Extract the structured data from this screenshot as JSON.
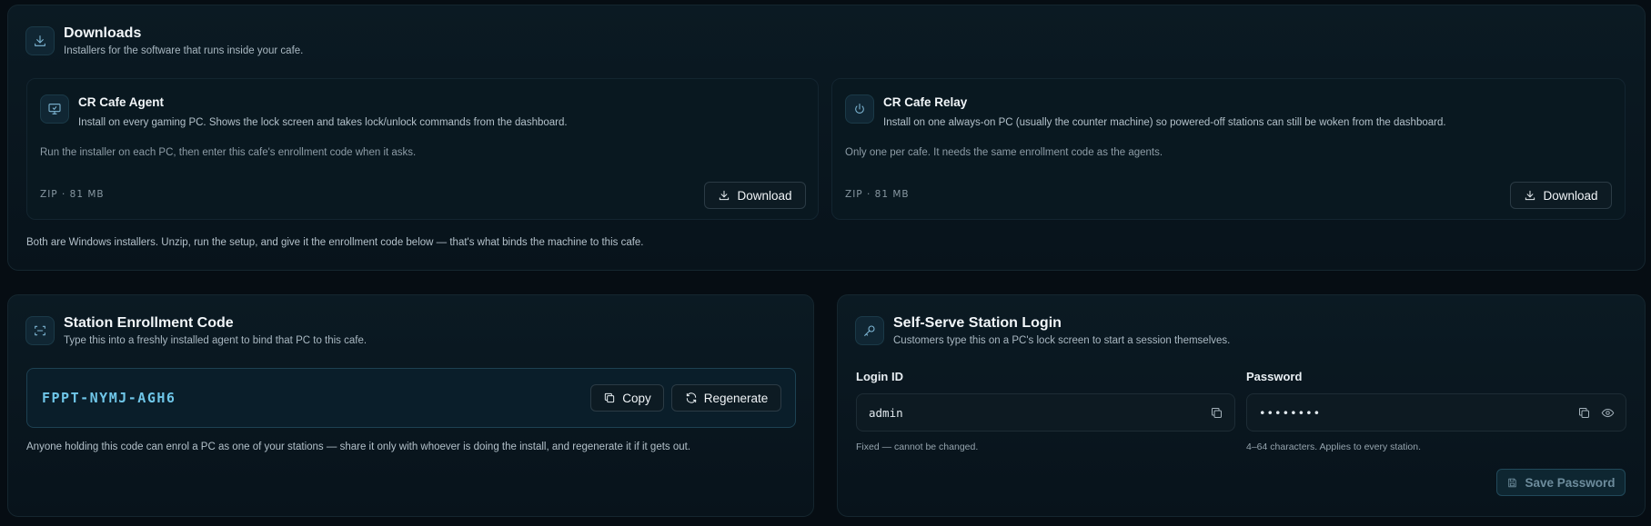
{
  "downloads": {
    "title": "Downloads",
    "subtitle": "Installers for the software that runs inside your cafe.",
    "icon": "download-icon",
    "agent": {
      "title": "CR Cafe Agent",
      "description": "Install on every gaming PC. Shows the lock screen and takes lock/unlock commands from the dashboard.",
      "note": "Run the installer on each PC, then enter this cafe's enrollment code when it asks.",
      "meta": "ZIP · 81 MB",
      "button_label": "Download",
      "icon": "monitor-icon"
    },
    "relay": {
      "title": "CR Cafe Relay",
      "description": "Install on one always-on PC (usually the counter machine) so powered-off stations can still be woken from the dashboard.",
      "note": "Only one per cafe. It needs the same enrollment code as the agents.",
      "meta": "ZIP · 81 MB",
      "button_label": "Download",
      "icon": "power-icon"
    },
    "footnote": "Both are Windows installers. Unzip, run the setup, and give it the enrollment code below — that's what binds the machine to this cafe."
  },
  "enrollment": {
    "title": "Station Enrollment Code",
    "subtitle": "Type this into a freshly installed agent to bind that PC to this cafe.",
    "code": "FPPT-NYMJ-AGH6",
    "copy_label": "Copy",
    "regenerate_label": "Regenerate",
    "footnote": "Anyone holding this code can enrol a PC as one of your stations — share it only with whoever is doing the install, and regenerate it if it gets out.",
    "icon": "scan-icon"
  },
  "login": {
    "title": "Self-Serve Station Login",
    "subtitle": "Customers type this on a PC's lock screen to start a session themselves.",
    "login_id_label": "Login ID",
    "login_id_value": "admin",
    "login_id_hint": "Fixed — cannot be changed.",
    "password_label": "Password",
    "password_value": "••••••••",
    "password_hint": "4–64 characters. Applies to every station.",
    "save_label": "Save Password",
    "icon": "key-icon"
  },
  "colors": {
    "background": "#060d13",
    "accent": "#6fc6e8"
  }
}
